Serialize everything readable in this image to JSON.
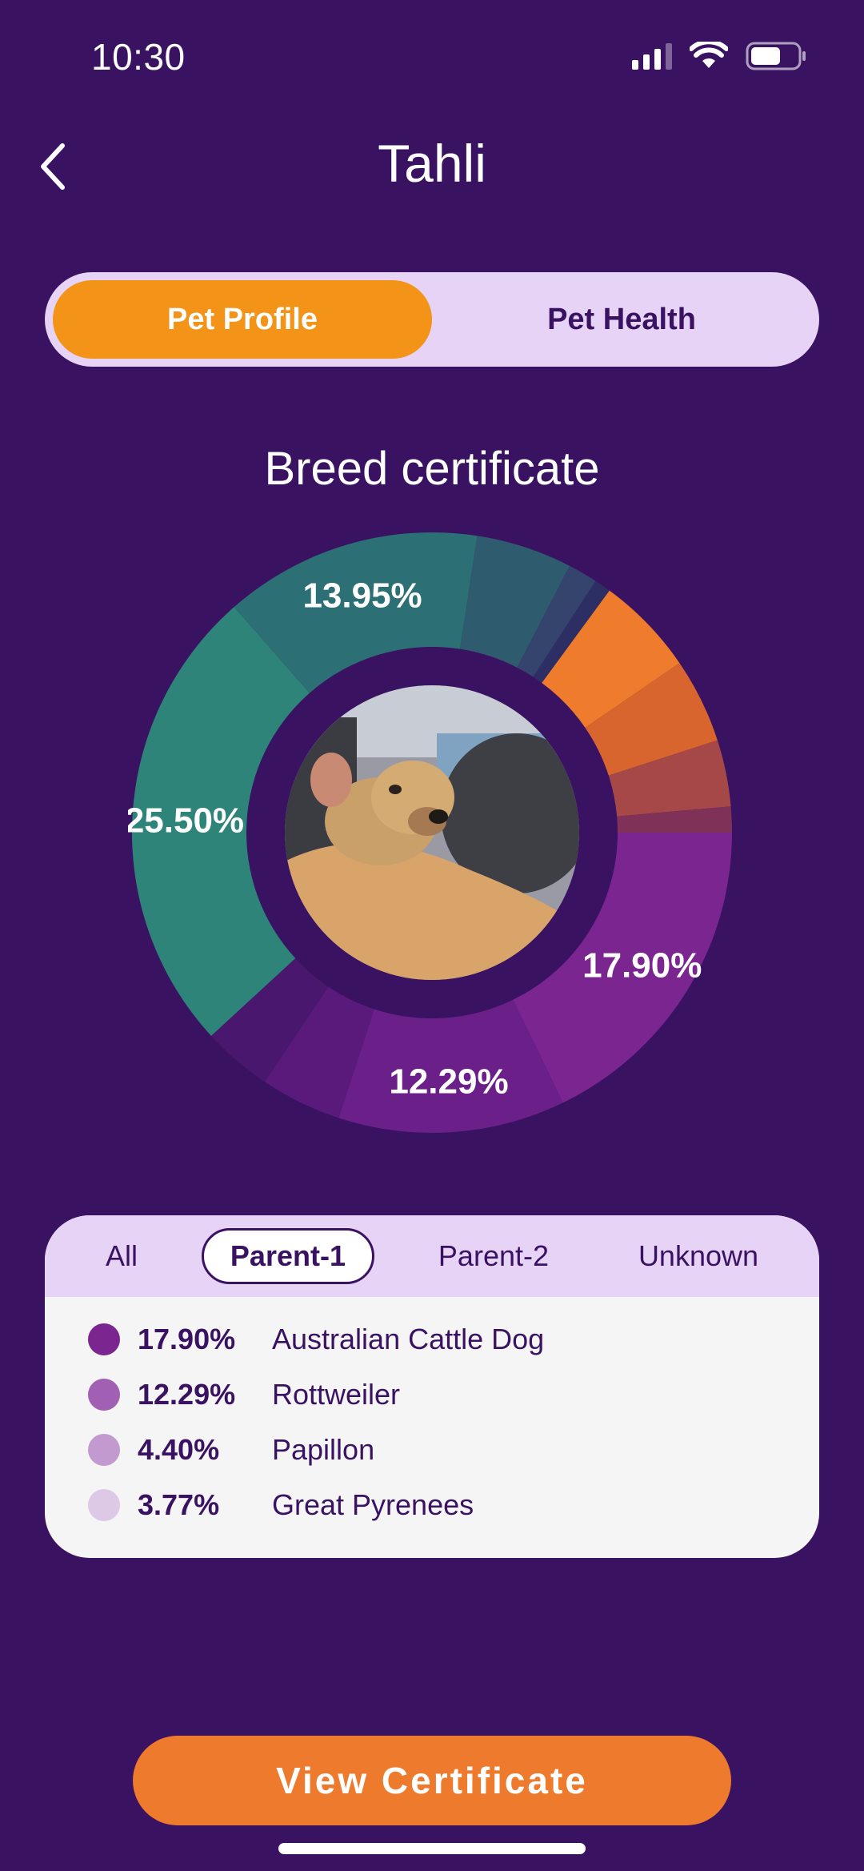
{
  "status_bar": {
    "time": "10:30",
    "signal_icon": "cellular-signal-icon",
    "wifi_icon": "wifi-icon",
    "battery_icon": "battery-icon"
  },
  "header": {
    "title": "Tahli",
    "back_icon": "chevron-left-icon"
  },
  "segment_tabs": [
    {
      "label": "Pet Profile",
      "active": true
    },
    {
      "label": "Pet Health",
      "active": false
    }
  ],
  "section_title": "Breed certificate",
  "chart_data": {
    "type": "pie",
    "style": "donut",
    "slices": [
      {
        "value": 17.9,
        "label": "17.90%",
        "color": "#7a2590"
      },
      {
        "value": 12.29,
        "label": "12.29%",
        "color": "#6a2088"
      },
      {
        "value": 4.4,
        "label": "",
        "color": "#5a1a7c"
      },
      {
        "value": 3.77,
        "label": "",
        "color": "#4a176e"
      },
      {
        "value": 25.5,
        "label": "25.50%",
        "color": "#2e8479"
      },
      {
        "value": 13.95,
        "label": "13.95%",
        "color": "#2c6f74"
      },
      {
        "value": 5.2,
        "label": "",
        "color": "#2e5b6e"
      },
      {
        "value": 1.6,
        "label": "",
        "color": "#34446c"
      },
      {
        "value": 0.9,
        "label": "",
        "color": "#2d2f64"
      },
      {
        "value": 5.4,
        "label": "",
        "color": "#ef7b2c"
      },
      {
        "value": 4.6,
        "label": "",
        "color": "#d8652e"
      },
      {
        "value": 3.6,
        "label": "",
        "color": "#a74848"
      },
      {
        "value": 1.4,
        "label": "",
        "color": "#7f3158"
      }
    ]
  },
  "breed_card": {
    "filters": [
      {
        "label": "All",
        "active": false
      },
      {
        "label": "Parent-1",
        "active": true
      },
      {
        "label": "Parent-2",
        "active": false
      },
      {
        "label": "Unknown",
        "active": false
      }
    ],
    "breeds": [
      {
        "percent": "17.90%",
        "name": "Australian Cattle Dog",
        "color": "#7a2590"
      },
      {
        "percent": "12.29%",
        "name": "Rottweiler",
        "color": "#a160b3"
      },
      {
        "percent": "4.40%",
        "name": "Papillon",
        "color": "#c39ad0"
      },
      {
        "percent": "3.77%",
        "name": "Great Pyrenees",
        "color": "#ddc9e6"
      }
    ]
  },
  "cta_label": "View Certificate"
}
